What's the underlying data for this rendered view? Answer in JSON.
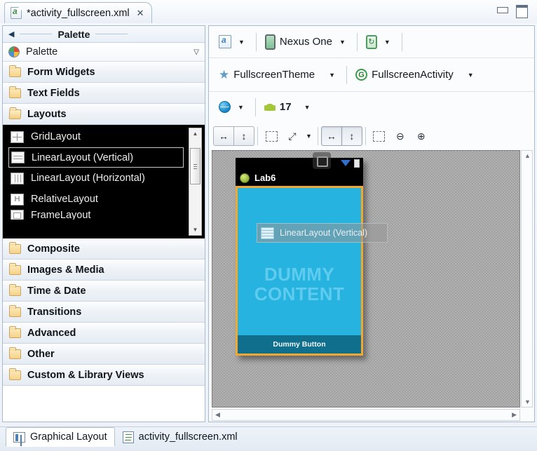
{
  "window": {
    "editor_tab_title": "*activity_fullscreen.xml",
    "close_glyph": "✕",
    "minimize_name": "minimize-button",
    "maximize_name": "maximize-button"
  },
  "palette": {
    "header_title": "Palette",
    "collapse_glyph": "◀",
    "sub_label": "Palette",
    "sub_caret": "▽",
    "categories": [
      {
        "label": "Form Widgets",
        "expanded": false
      },
      {
        "label": "Text Fields",
        "expanded": false
      },
      {
        "label": "Layouts",
        "expanded": true
      },
      {
        "label": "Composite",
        "expanded": false
      },
      {
        "label": "Images & Media",
        "expanded": false
      },
      {
        "label": "Time & Date",
        "expanded": false
      },
      {
        "label": "Transitions",
        "expanded": false
      },
      {
        "label": "Advanced",
        "expanded": false
      },
      {
        "label": "Other",
        "expanded": false
      },
      {
        "label": "Custom & Library Views",
        "expanded": false
      }
    ],
    "layout_items": [
      {
        "label": "GridLayout",
        "icon": "grid-layout-icon",
        "selected": false
      },
      {
        "label": "LinearLayout (Vertical)",
        "icon": "linear-layout-vertical-icon",
        "selected": true
      },
      {
        "label": "LinearLayout (Horizontal)",
        "icon": "linear-layout-horizontal-icon",
        "selected": false
      },
      {
        "label": "RelativeLayout",
        "icon": "relative-layout-icon",
        "selected": false
      },
      {
        "label": "FrameLayout",
        "icon": "frame-layout-icon",
        "selected": false
      }
    ],
    "scroll_up_glyph": "▲",
    "scroll_down_glyph": "▼"
  },
  "toolbar": {
    "config_label": "",
    "device_label": "Nexus One",
    "orientation_label": "",
    "theme_label": "FullscreenTheme",
    "activity_label": "FullscreenActivity",
    "locale_label": "",
    "api_level": "17",
    "caret_glyph": "▼",
    "buttons": {
      "match_width": "↔",
      "match_height": "↕",
      "wrap_content": "",
      "expand": "⤢",
      "zoom_out": "⊖",
      "zoom_in": "⊕"
    }
  },
  "canvas": {
    "device": {
      "app_title": "Lab6",
      "dummy_content_line1": "DUMMY",
      "dummy_content_line2": "CONTENT",
      "dummy_button_label": "Dummy Button"
    },
    "drag_ghost_label": "LinearLayout (Vertical)",
    "scroll_up_glyph": "▲",
    "scroll_down_glyph": "▼",
    "scroll_left_glyph": "◀",
    "scroll_right_glyph": "▶"
  },
  "bottom_tabs": [
    {
      "label": "Graphical Layout",
      "active": true
    },
    {
      "label": "activity_fullscreen.xml",
      "active": false
    }
  ],
  "colors": {
    "selection_orange": "#f0a830",
    "content_cyan": "#27b3e0",
    "bottom_bar_teal": "#0f6f8c",
    "android_green": "#a4c639"
  }
}
